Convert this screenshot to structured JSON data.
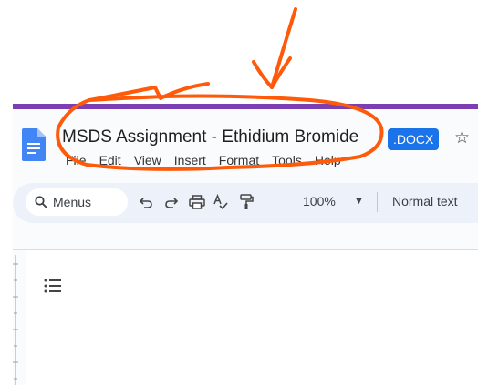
{
  "document": {
    "title": "MSDS Assignment - Ethidium Bromide",
    "format_badge": ".DOCX"
  },
  "menubar": {
    "items": [
      "File",
      "Edit",
      "View",
      "Insert",
      "Format",
      "Tools",
      "Help"
    ]
  },
  "toolbar": {
    "search_label": "Menus",
    "zoom": "100%",
    "paragraph_style": "Normal text"
  },
  "icons": {
    "app": "docs-icon",
    "star": "star-icon",
    "search": "search-icon",
    "undo": "undo-icon",
    "redo": "redo-icon",
    "print": "print-icon",
    "spellcheck": "spellcheck-icon",
    "paint_format": "paint-format-icon",
    "outline": "outline-icon"
  },
  "colors": {
    "accent_blue": "#1a73e8",
    "annotation_orange": "#ff5a0a",
    "top_bar_purple": "#7b3fb3"
  }
}
